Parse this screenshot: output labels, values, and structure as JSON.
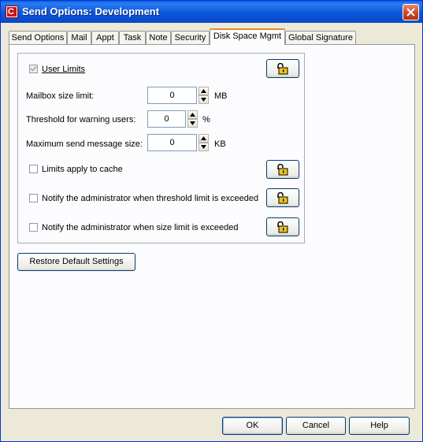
{
  "window": {
    "title": "Send Options:  Development"
  },
  "tabs": [
    {
      "label": "Send Options",
      "active": false
    },
    {
      "label": "Mail",
      "active": false
    },
    {
      "label": "Appt",
      "active": false
    },
    {
      "label": "Task",
      "active": false
    },
    {
      "label": "Note",
      "active": false
    },
    {
      "label": "Security",
      "active": false
    },
    {
      "label": "Disk Space Mgmt",
      "active": true
    },
    {
      "label": "Global Signature",
      "active": false
    }
  ],
  "disk_space": {
    "user_limits": {
      "label": "User Limits",
      "checked": true,
      "disabled": true
    },
    "mailbox_size": {
      "label": "Mailbox size limit:",
      "value": "0",
      "unit": "MB"
    },
    "threshold": {
      "label": "Threshold for warning users:",
      "value": "0",
      "unit": "%"
    },
    "max_send": {
      "label": "Maximum send message size:",
      "value": "0",
      "unit": "KB"
    },
    "limits_cache": {
      "label": "Limits apply to cache",
      "checked": false
    },
    "notify_threshold": {
      "label": "Notify the administrator when threshold limit is exceeded",
      "checked": false
    },
    "notify_size": {
      "label": "Notify the administrator when size limit is exceeded",
      "checked": false
    },
    "restore_label": "Restore Default Settings"
  },
  "footer": {
    "ok": "OK",
    "cancel": "Cancel",
    "help": "Help"
  },
  "colors": {
    "title_bar": "#0a5fe0",
    "dialog_bg": "#ece9d8",
    "panel_bg": "#fcfcfe",
    "active_tab_accent": "#e68b2c",
    "lock_icon": "#f0c419"
  },
  "icons": [
    "app-icon",
    "close-icon",
    "lock-icon",
    "spin-up-icon",
    "spin-down-icon",
    "checkmark-icon"
  ]
}
